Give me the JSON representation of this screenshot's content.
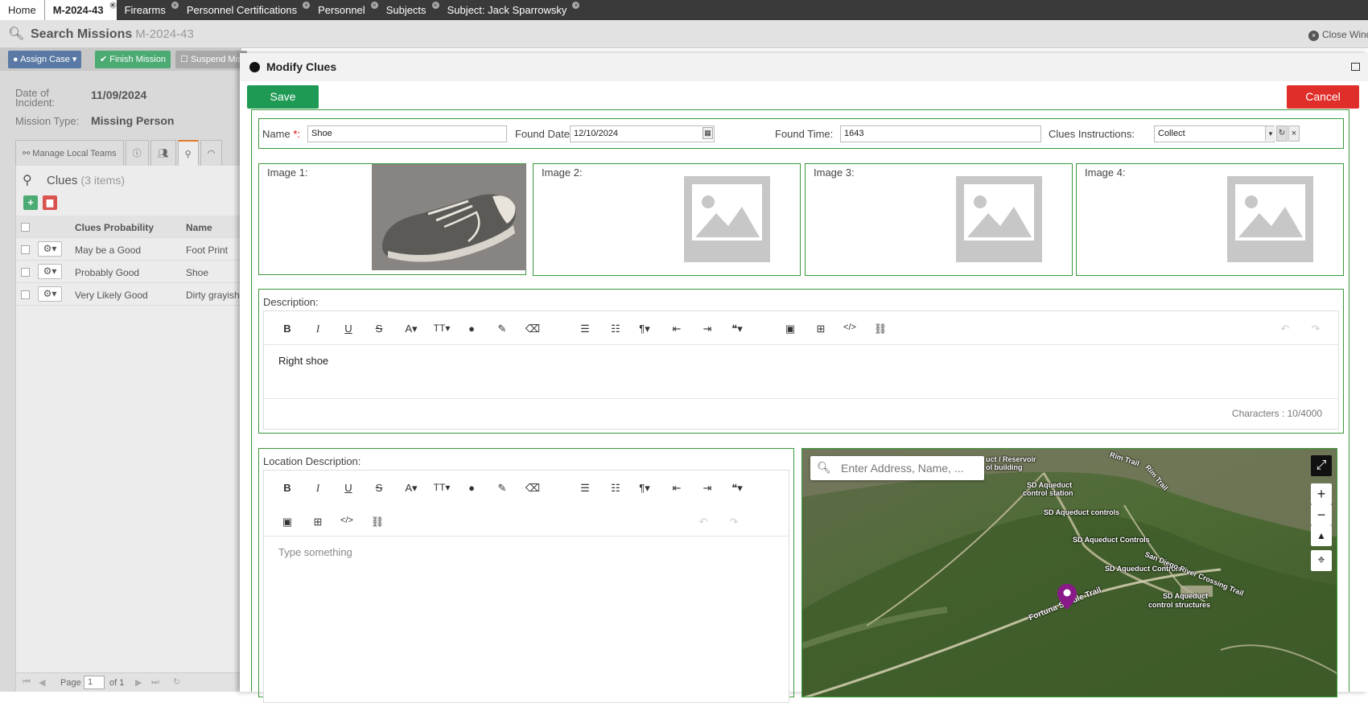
{
  "tabs": [
    {
      "label": "Home"
    },
    {
      "label": "M-2024-43"
    },
    {
      "label": "Firearms"
    },
    {
      "label": "Personnel Certifications"
    },
    {
      "label": "Personnel"
    },
    {
      "label": "Subjects"
    },
    {
      "label": "Subject: Jack Sparrowsky"
    }
  ],
  "search": {
    "title": "Search Missions",
    "mission_id": "M-2024-43",
    "close_window": "Close Window"
  },
  "actions": {
    "assign_case": "Assign Case",
    "finish_mission": "Finish Mission",
    "suspend_mission": "Suspend Mis"
  },
  "incident": {
    "date_label": "Date of Incident:",
    "date_value": "11/09/2024",
    "type_label": "Mission Type:",
    "type_value": "Missing Person"
  },
  "left_tabs": {
    "manage_local_teams": "Manage Local Teams"
  },
  "clues": {
    "title": "Clues",
    "count": "(3 items)",
    "columns": {
      "probability": "Clues Probability",
      "name": "Name"
    },
    "rows": [
      {
        "probability": "May be a Good",
        "name": "Foot Print"
      },
      {
        "probability": "Probably Good",
        "name": "Shoe"
      },
      {
        "probability": "Very Likely Good",
        "name": "Dirty grayish"
      }
    ],
    "pager": {
      "page_label": "Page",
      "page": "1",
      "of": "of 1"
    }
  },
  "modal": {
    "title": "Modify Clues",
    "save": "Save",
    "cancel": "Cancel",
    "name_label": "Name",
    "required": "*:",
    "name_value": "Shoe",
    "found_date_label": "Found Date:",
    "found_date_value": "12/10/2024",
    "found_time_label": "Found Time:",
    "found_time_value": "1643",
    "instructions_label": "Clues Instructions:",
    "instructions_value": "Collect",
    "images": [
      "Image 1:",
      "Image 2:",
      "Image 3:",
      "Image 4:"
    ],
    "description_label": "Description:",
    "description_text": "Right shoe",
    "char_count": "Characters : 10/4000",
    "location_label": "Location Description:",
    "location_placeholder": "Type something",
    "map_search_placeholder": "Enter Address, Name, ...",
    "map_labels": [
      "uct / Reservoir",
      "ol building",
      "SD Aqueduct",
      "control station",
      "SD Aqueduct controls",
      "SD Aqueduct Controls",
      "SD Aqueduct Controls",
      "SD Aqueduct",
      "control structures",
      "San Diego River Crossing Trail",
      "Fortuna Saddle Trail",
      "Rim Trail",
      "Rim Trail"
    ]
  },
  "colors": {
    "save": "#1f9a55",
    "cancel": "#e02e2a",
    "border": "#3a9a3a",
    "marker": "#8a1a8a"
  }
}
